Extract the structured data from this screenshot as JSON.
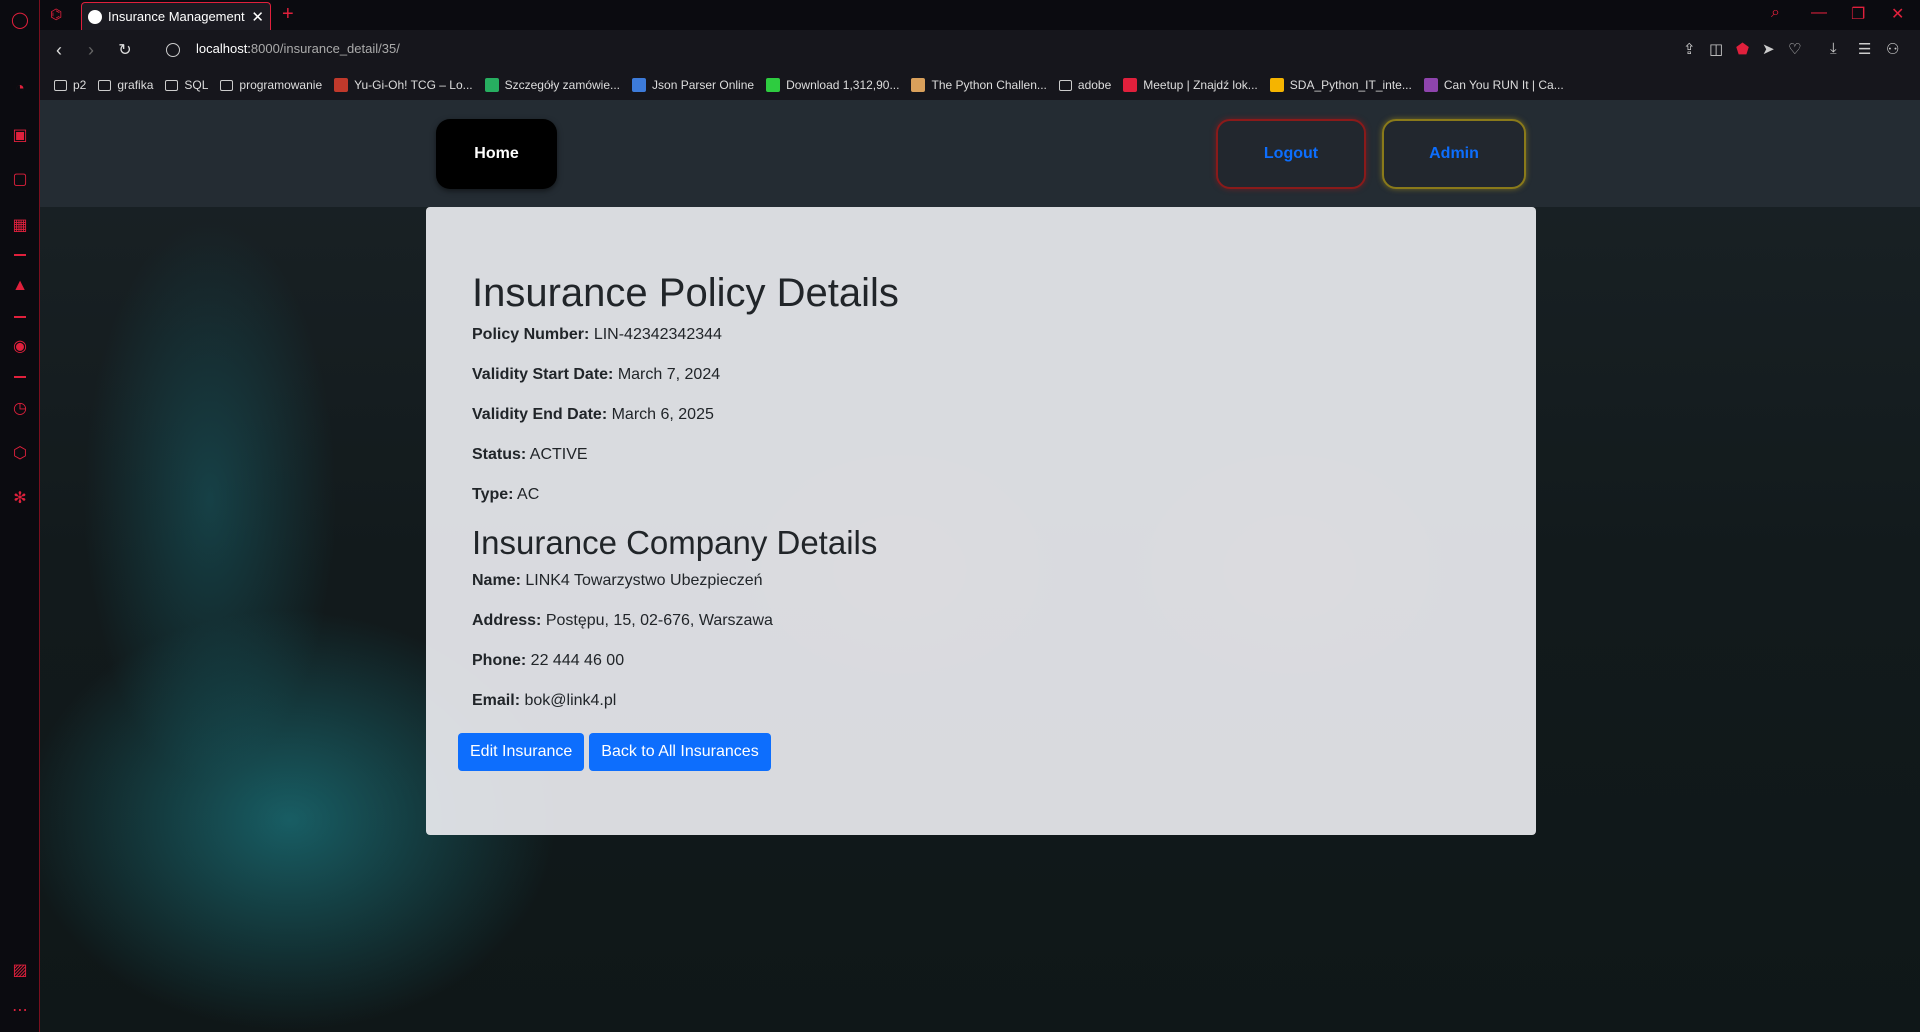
{
  "browser": {
    "tab_title": "Insurance Management Ap",
    "url_host": "localhost:",
    "url_path": "8000/insurance_detail/35/"
  },
  "bookmarks": [
    {
      "label": "p2",
      "type": "folder"
    },
    {
      "label": "grafika",
      "type": "folder"
    },
    {
      "label": "SQL",
      "type": "folder"
    },
    {
      "label": "programowanie",
      "type": "folder"
    },
    {
      "label": "Yu-Gi-Oh! TCG – Lo...",
      "type": "site",
      "color": "#c0392b"
    },
    {
      "label": "Szczegóły zamówie...",
      "type": "site",
      "color": "#27ae60"
    },
    {
      "label": "Json Parser Online",
      "type": "site",
      "color": "#3d7bd9"
    },
    {
      "label": "Download 1,312,90...",
      "type": "site",
      "color": "#2ecc40"
    },
    {
      "label": "The Python Challen...",
      "type": "site",
      "color": "#d9a05b"
    },
    {
      "label": "adobe",
      "type": "folder"
    },
    {
      "label": "Meetup | Znajdź lok...",
      "type": "site",
      "color": "#e0203c"
    },
    {
      "label": "SDA_Python_IT_inte...",
      "type": "site",
      "color": "#f5b400"
    },
    {
      "label": "Can You RUN It | Ca...",
      "type": "site",
      "color": "#8e44ad"
    }
  ],
  "nav": {
    "home": "Home",
    "logout": "Logout",
    "admin": "Admin"
  },
  "policy": {
    "heading": "Insurance Policy Details",
    "policy_number_label": "Policy Number:",
    "policy_number": "LIN-42342342344",
    "start_label": "Validity Start Date:",
    "start": "March 7, 2024",
    "end_label": "Validity End Date:",
    "end": "March 6, 2025",
    "status_label": "Status:",
    "status": "ACTIVE",
    "type_label": "Type:",
    "type": "AC"
  },
  "company": {
    "heading": "Insurance Company Details",
    "name_label": "Name:",
    "name": "LINK4 Towarzystwo Ubezpieczeń",
    "address_label": "Address:",
    "address": "Postępu, 15, 02-676, Warszawa",
    "phone_label": "Phone:",
    "phone": "22 444 46 00",
    "email_label": "Email:",
    "email": "bok@link4.pl"
  },
  "actions": {
    "edit": "Edit Insurance",
    "back": "Back to All Insurances"
  },
  "colors": {
    "accent": "#e0203c",
    "primary_button": "#0d6efd"
  }
}
